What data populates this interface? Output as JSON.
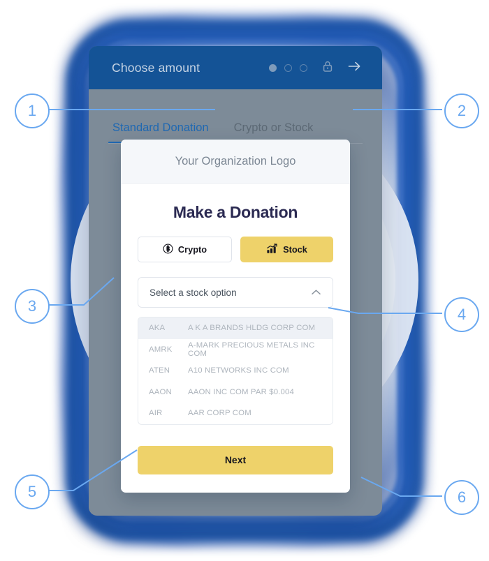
{
  "device": {
    "topbar": {
      "title": "Choose amount",
      "progress_dots": [
        "filled",
        "hollow",
        "hollow"
      ],
      "lock_icon": "lock-icon",
      "next_arrow_icon": "arrow-right-icon"
    },
    "tabs": [
      {
        "label": "Standard Donation",
        "active": true
      },
      {
        "label": "Crypto or Stock",
        "active": false
      }
    ]
  },
  "card": {
    "header_logo_text": "Your Organization Logo",
    "title": "Make a Donation",
    "toggle": [
      {
        "label": "Crypto",
        "icon": "bitcoin-icon",
        "selected": false
      },
      {
        "label": "Stock",
        "icon": "bar-chart-trend-icon",
        "selected": true
      }
    ],
    "select": {
      "value": "Select a stock option",
      "placeholder": "Select a stock option",
      "chevron_icon": "chevron-up-icon",
      "expanded": true
    },
    "options": [
      {
        "symbol": "AKA",
        "name": "A K A BRANDS HLDG CORP COM",
        "highlighted": true
      },
      {
        "symbol": "AMRK",
        "name": "A-MARK PRECIOUS METALS INC COM",
        "highlighted": false
      },
      {
        "symbol": "ATEN",
        "name": "A10 NETWORKS INC COM",
        "highlighted": false
      },
      {
        "symbol": "AAON",
        "name": "AAON INC COM PAR $0.004",
        "highlighted": false
      },
      {
        "symbol": "AIR",
        "name": "AAR CORP COM",
        "highlighted": false
      }
    ],
    "next_button": "Next"
  },
  "callouts": [
    {
      "number": "1",
      "side": "left"
    },
    {
      "number": "2",
      "side": "right"
    },
    {
      "number": "3",
      "side": "left"
    },
    {
      "number": "4",
      "side": "right"
    },
    {
      "number": "5",
      "side": "left"
    },
    {
      "number": "6",
      "side": "right"
    }
  ],
  "colors": {
    "topbar_blue": "#145396",
    "device_gray": "#7d8b98",
    "tab_active": "#1f68b2",
    "accent_yellow": "#eed26a",
    "title_navy": "#2b2a52",
    "callout_blue": "#6aa8f0",
    "frame_blue": "#1b53a8"
  }
}
